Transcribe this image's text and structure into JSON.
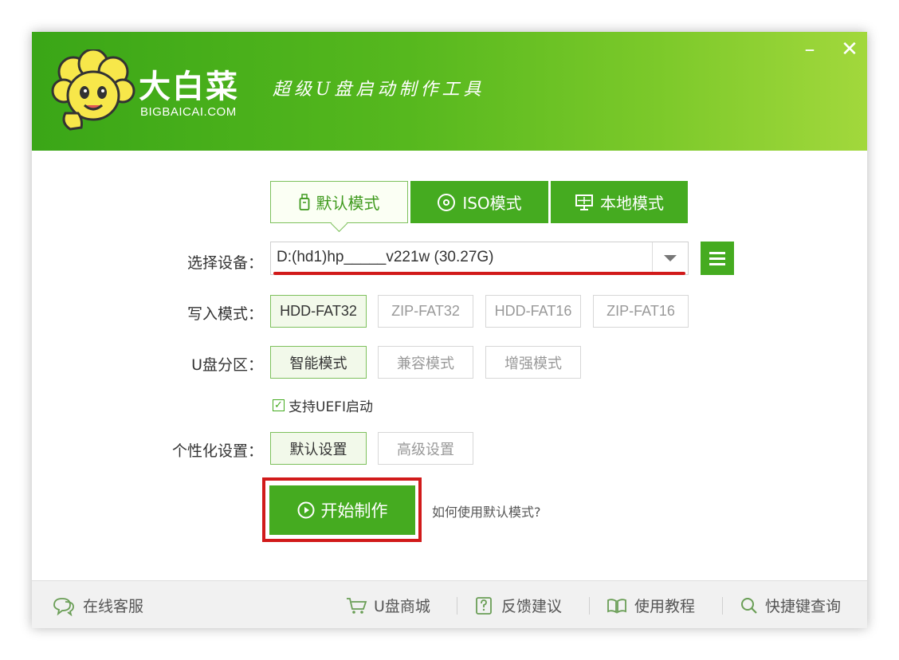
{
  "brand": {
    "name_cn": "大白菜",
    "name_en": "BIGBAICAI.COM",
    "slogan": "超级U盘启动制作工具"
  },
  "window_controls": {
    "minimize": "–",
    "close": "✕"
  },
  "tabs": [
    {
      "label": "默认模式",
      "icon": "usb-drive-icon",
      "selected": true
    },
    {
      "label": "ISO模式",
      "icon": "disc-icon",
      "selected": false
    },
    {
      "label": "本地模式",
      "icon": "monitor-icon",
      "selected": false
    }
  ],
  "device": {
    "label": "选择设备：",
    "value": "D:(hd1)hp_____v221w (30.27G)"
  },
  "write_mode": {
    "label": "写入模式：",
    "options": [
      "HDD-FAT32",
      "ZIP-FAT32",
      "HDD-FAT16",
      "ZIP-FAT16"
    ],
    "selected": "HDD-FAT32"
  },
  "partition": {
    "label": "U盘分区：",
    "options": [
      "智能模式",
      "兼容模式",
      "增强模式"
    ],
    "selected": "智能模式"
  },
  "uefi": {
    "label": "支持UEFI启动",
    "checked": true
  },
  "personalize": {
    "label": "个性化设置：",
    "options": [
      "默认设置",
      "高级设置"
    ],
    "selected": "默认设置"
  },
  "start_button": "开始制作",
  "help_link": "如何使用默认模式?",
  "footer": {
    "online_service": "在线客服",
    "shop": "U盘商城",
    "feedback": "反馈建议",
    "tutorial": "使用教程",
    "shortcuts": "快捷键查询"
  },
  "colors": {
    "accent_green": "#45ab20",
    "highlight_red": "#d11a1a"
  }
}
